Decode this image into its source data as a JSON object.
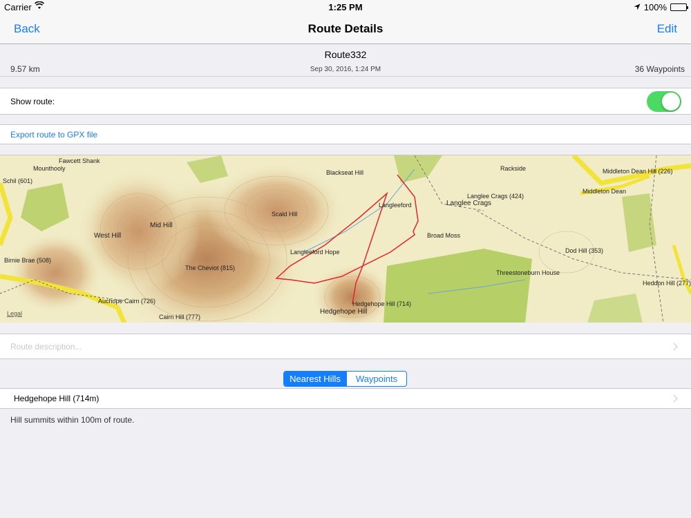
{
  "status_bar": {
    "carrier": "Carrier",
    "time": "1:25 PM",
    "battery": "100%"
  },
  "nav": {
    "back_label": "Back",
    "title": "Route Details",
    "edit_label": "Edit"
  },
  "route": {
    "name": "Route332",
    "distance": "9.57 km",
    "date": "Sep 30, 2016, 1:24 PM",
    "waypoints": "36 Waypoints"
  },
  "show_route": {
    "label": "Show route:",
    "enabled": true
  },
  "export": {
    "label": "Export route to GPX file"
  },
  "map": {
    "legal": "Legal",
    "labels": [
      "Fawcett Shank",
      "Mounthooly",
      "Schil (601)",
      "West Hill",
      "Mid Hill",
      "Birnie Brae (508)",
      "Auchope Cairn (726)",
      "The Cheviot (815)",
      "Cairn Hill (777)",
      "Scald Hill",
      "Blackseat Hill",
      "Langleeford",
      "Langlee Crags",
      "Langlee Crags (424)",
      "Broad Moss",
      "Hedgehope Hill (714)",
      "Hedgehope Hill",
      "Rackside",
      "Middleton Dean Hill (226)",
      "Middleton Dean",
      "Dod Hill (353)",
      "Threestoneburn House",
      "Heddon Hill (277)",
      "Langleeford Hope"
    ]
  },
  "description": {
    "placeholder": "Route description..."
  },
  "segmented": {
    "options": [
      "Nearest Hills",
      "Waypoints"
    ],
    "selected": "Nearest Hills"
  },
  "hills": [
    {
      "name": "Hedgehope Hill (714m)"
    }
  ],
  "footnote": "Hill summits within 100m of route.",
  "colors": {
    "accent": "#157efb",
    "toggle_on": "#4cd964",
    "route_line": "#e3252a"
  }
}
